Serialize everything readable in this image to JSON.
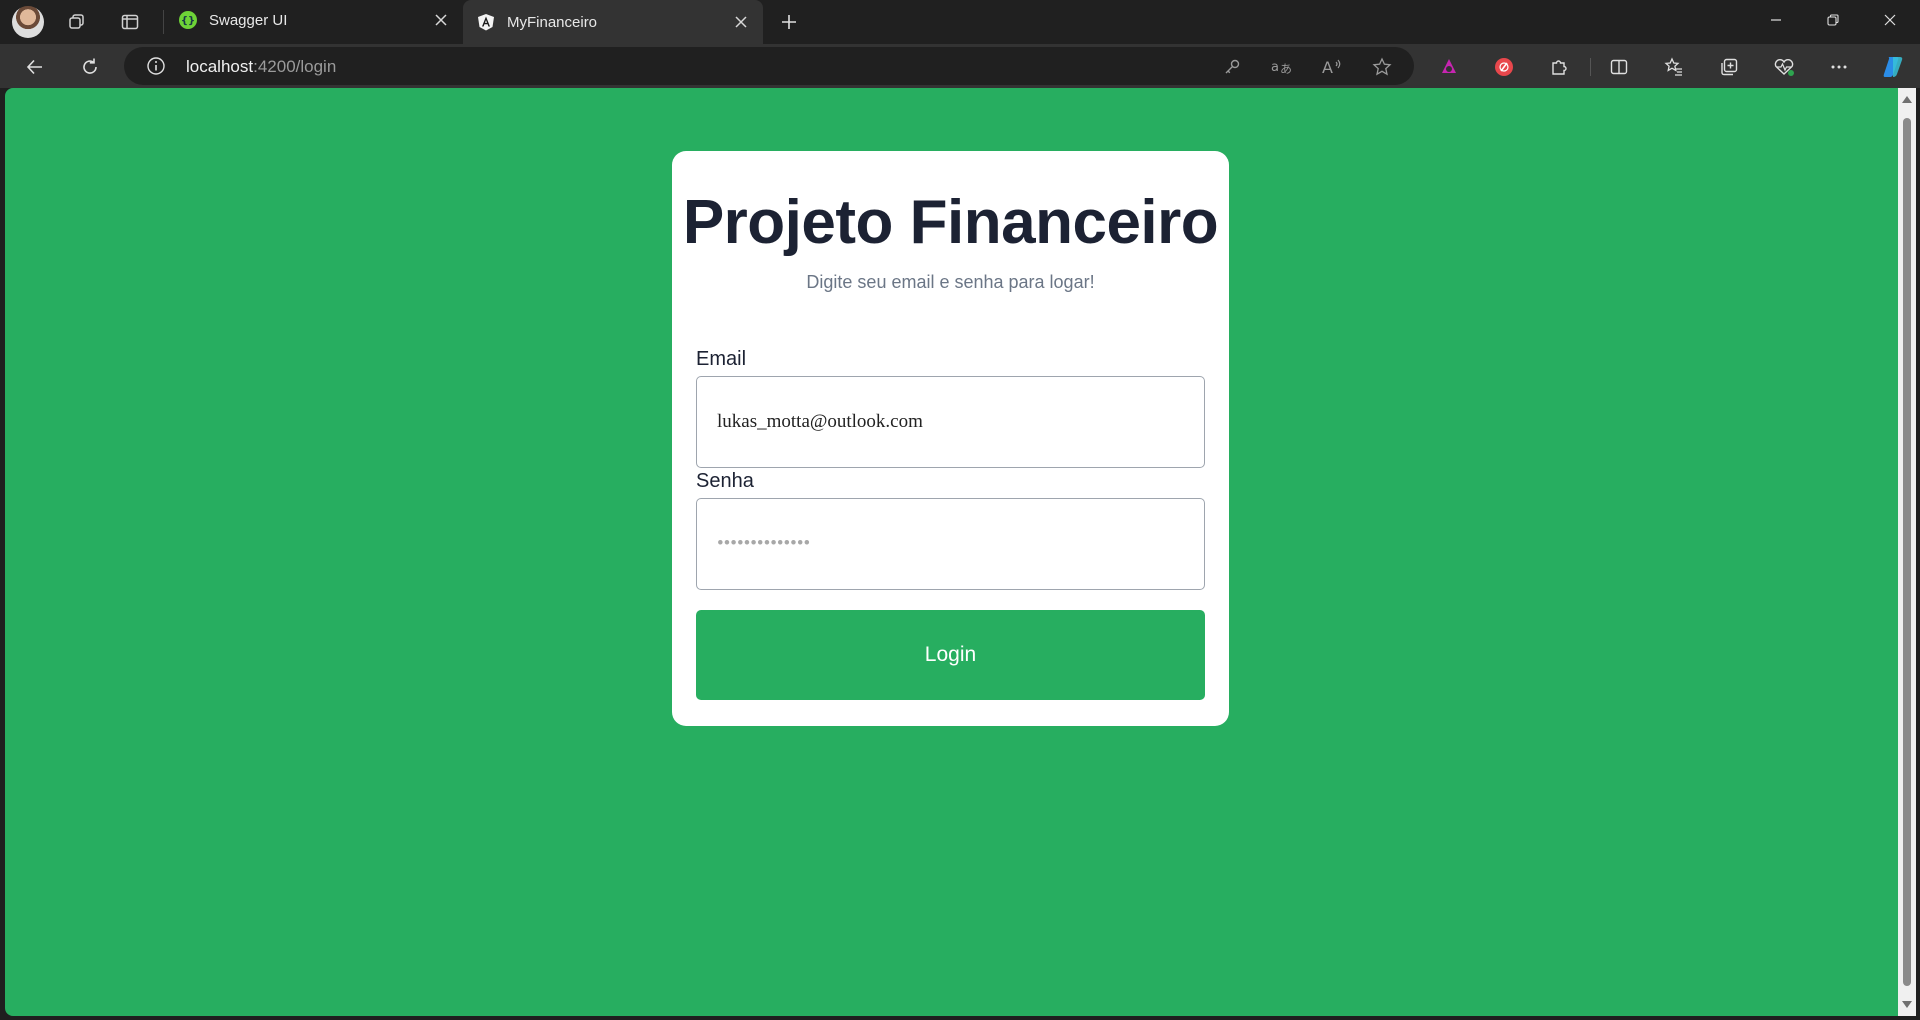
{
  "browser": {
    "tabs": [
      {
        "title": "Swagger UI",
        "icon": "swagger-icon",
        "active": false
      },
      {
        "title": "MyFinanceiro",
        "icon": "angular-icon",
        "active": true
      }
    ],
    "address": {
      "host": "localhost",
      "path": ":4200/login"
    },
    "colors": {
      "tabstrip": "#202020",
      "toolbar": "#333333"
    }
  },
  "page": {
    "background": "#27ae60",
    "title": "Projeto Financeiro",
    "subtitle": "Digite seu email e senha para logar!",
    "email": {
      "label": "Email",
      "value": "lukas_motta@outlook.com"
    },
    "password": {
      "label": "Senha",
      "placeholder": "••••••••••••••"
    },
    "login_label": "Login"
  }
}
